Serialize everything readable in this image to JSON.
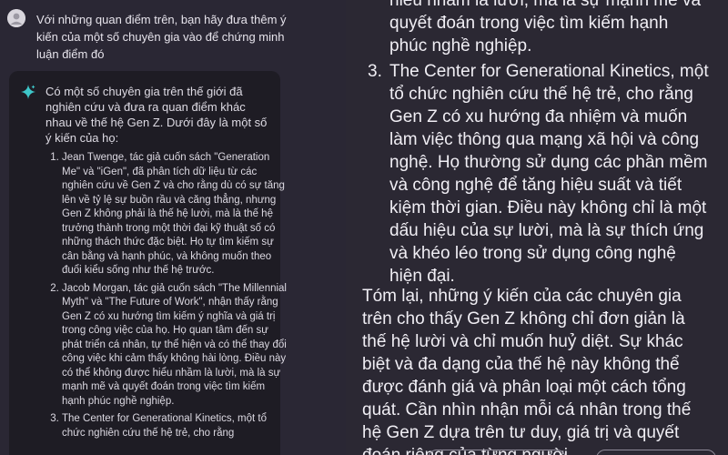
{
  "user_message": {
    "text": "Với những quan điểm trên, bạn hãy đưa thêm ý kiến của một số chuyên gia vào để chứng minh luận điểm đó"
  },
  "ai_message": {
    "intro": "Có một số chuyên gia trên thế giới đã nghiên cứu và đưa ra quan điểm khác nhau về thế hệ Gen Z. Dưới đây là một số ý kiến của họ:",
    "items": [
      "Jean Twenge, tác giả cuốn sách \"Generation Me\" và \"iGen\", đã phân tích dữ liệu từ các nghiên cứu về Gen Z và cho rằng dù có sự tăng lên về tỷ lệ sự buồn rầu và căng thẳng, nhưng Gen Z không phải là thế hệ lười, mà là thế hệ trưởng thành trong một thời đại kỹ thuật số có những thách thức đặc biệt. Họ tự tìm kiếm sự cân bằng và hạnh phúc, và không muốn theo đuổi kiểu sống như thế hệ trước.",
      "Jacob Morgan, tác giả cuốn sách \"The Millennial Myth\" và \"The Future of Work\", nhận thấy rằng Gen Z có xu hướng tìm kiếm ý nghĩa và giá trị trong công việc của họ. Họ quan tâm đến sự phát triển cá nhân, tự thể hiện và có thể thay đổi công việc khi cảm thấy không hài lòng. Điều này có thể không được hiểu nhầm là lười, mà là sự mạnh mẽ và quyết đoán trong việc tìm kiếm hạnh phúc nghề nghiệp.",
      "The Center for Generational Kinetics, một tổ chức nghiên cứu thế hệ trẻ, cho rằng"
    ]
  },
  "zoomed_view": {
    "continuation": "hiểu nhầm là lười, mà là sự mạnh mẽ và quyết đoán trong việc tìm kiếm hạnh phúc nghề nghiệp.",
    "item_3_number": "3.",
    "item_3_text": "The Center for Generational Kinetics, một tổ chức nghiên cứu thế hệ trẻ, cho rằng Gen Z có xu hướng đa nhiệm và muốn làm việc thông qua mạng xã hội và công nghệ. Họ thường sử dụng các phần mềm và công nghệ để tăng hiệu suất và tiết kiệm thời gian. Điều này không chỉ là một dấu hiệu của sự lười, mà là sự thích ứng và khéo léo trong sử dụng công nghệ hiện đại.",
    "summary": "Tóm lại, những ý kiến của các chuyên gia trên cho thấy Gen Z không chỉ đơn giản là thế hệ lười và chỉ muốn huỷ diệt. Sự khác biệt và đa dạng của thế hệ này không thể được đánh giá và phân loại một cách tổng quát. Cần nhìn nhận mỗi cá nhân trong thế hệ Gen Z dựa trên tư duy, giá trị và quyết đoán riêng của từng người."
  },
  "colors": {
    "background": "#2b2833",
    "ai_card": "#1e1c24",
    "sparkle_accent": "#3ec6c9"
  },
  "icons": {
    "user_avatar": "user-avatar-icon",
    "ai_sparkle": "sparkle-icon"
  }
}
